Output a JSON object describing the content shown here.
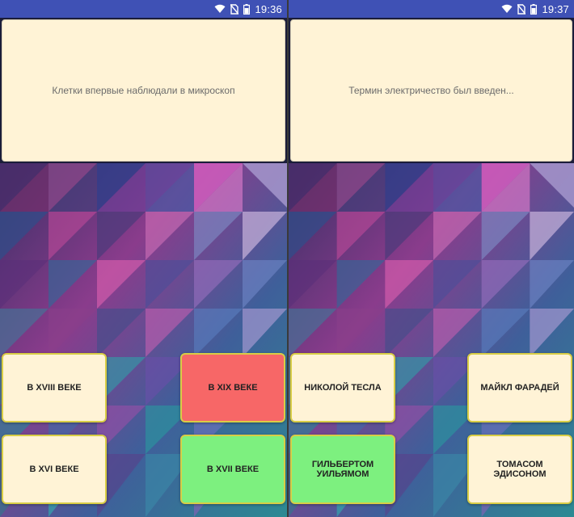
{
  "screens": [
    {
      "status_bar": {
        "time": "19:36",
        "icons": [
          "wifi-icon",
          "no-sim-icon",
          "battery-icon"
        ]
      },
      "question": "Клетки впервые наблюдали в микроскоп",
      "answers": [
        {
          "label": "В XVIII ВЕКЕ",
          "state": "neutral",
          "color": "#fff3d6"
        },
        {
          "label": "В XIX ВЕКЕ",
          "state": "wrong",
          "color": "#f76767"
        },
        {
          "label": "В XVI ВЕКЕ",
          "state": "neutral",
          "color": "#fff3d6"
        },
        {
          "label": "В XVII ВЕКЕ",
          "state": "correct",
          "color": "#7df07f"
        }
      ]
    },
    {
      "status_bar": {
        "time": "19:37",
        "icons": [
          "wifi-icon",
          "no-sim-icon",
          "battery-icon"
        ]
      },
      "question": "Термин электричество был введен...",
      "answers": [
        {
          "label": "НИКОЛОЙ ТЕСЛА",
          "state": "neutral",
          "color": "#fff3d6"
        },
        {
          "label": "МАЙКЛ ФАРАДЕЙ",
          "state": "neutral",
          "color": "#fff3d6"
        },
        {
          "label": "ГИЛЬБЕРТОМ УИЛЬЯМОМ",
          "state": "correct",
          "color": "#7df07f"
        },
        {
          "label": "ТОМАСОМ ЭДИСОНОМ",
          "state": "neutral",
          "color": "#fff3d6"
        }
      ]
    }
  ],
  "colors": {
    "status_bar": "#3f51b5",
    "card_background": "#fff3d6",
    "button_border": "#d8cd45"
  }
}
